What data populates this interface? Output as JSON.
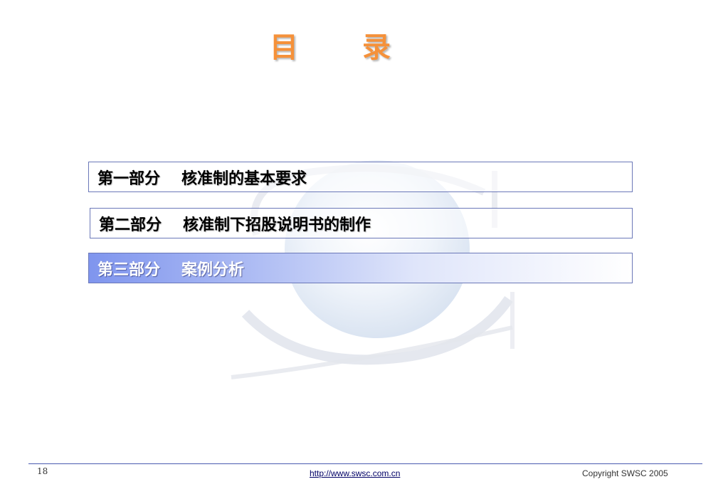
{
  "slide": {
    "title": "目 录"
  },
  "toc": {
    "items": [
      {
        "part": "第一部分",
        "text": "核准制的基本要求"
      },
      {
        "part": "第二部分",
        "text": "核准制下招股说明书的制作"
      },
      {
        "part": "第三部分",
        "text": "案例分析"
      }
    ],
    "active_index": 2
  },
  "footer": {
    "page_number": "18",
    "url": "http://www.swsc.com.cn",
    "copyright": "Copyright SWSC 2005"
  },
  "colors": {
    "title": "#f5913a",
    "border": "#6b78b8",
    "active_gradient_start": "#7f95ee",
    "footer_line": "#4a5ab0"
  },
  "icons": {
    "watermark": "globe-swoosh-logo-watermark"
  }
}
